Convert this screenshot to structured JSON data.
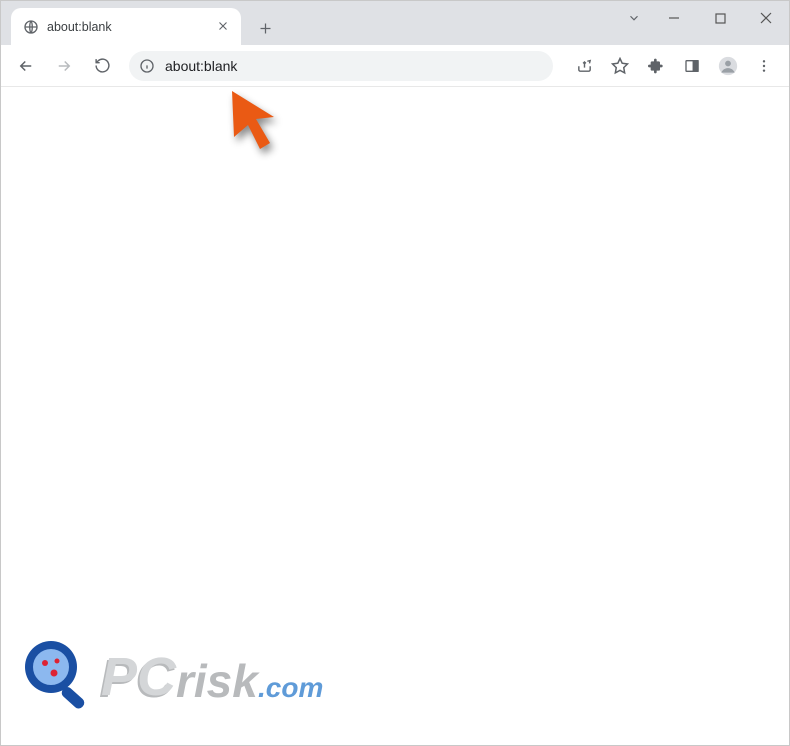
{
  "window": {
    "tab_title": "about:blank",
    "address_url": "about:blank"
  },
  "watermark": {
    "text_prefix": "PC",
    "text_suffix": "risk",
    "tld": ".com"
  }
}
